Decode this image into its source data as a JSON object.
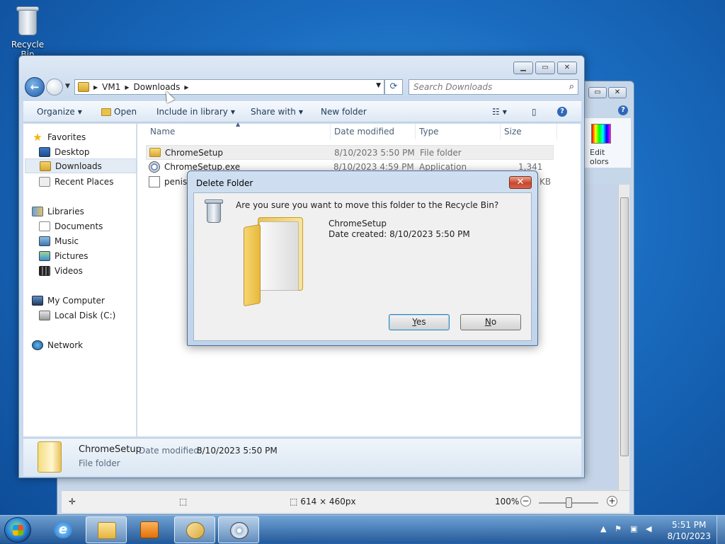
{
  "desktop": {
    "recycle_bin_label": "Recycle Bin"
  },
  "paint_window": {
    "edit_colors_label": "Edit colors",
    "edit_colors_visible": "Edit\nolors",
    "status": {
      "dimensions": "614 × 460px",
      "zoom": "100%",
      "zoom_minus": "−",
      "zoom_plus": "+"
    }
  },
  "explorer": {
    "address": {
      "segments": [
        "VM1",
        "Downloads"
      ]
    },
    "search_placeholder": "Search Downloads",
    "toolbar": {
      "organize": "Organize",
      "open": "Open",
      "include_in_library": "Include in library",
      "share_with": "Share with",
      "new_folder": "New folder"
    },
    "nav": {
      "favorites": "Favorites",
      "desktop": "Desktop",
      "downloads": "Downloads",
      "recent_places": "Recent Places",
      "libraries": "Libraries",
      "documents": "Documents",
      "music": "Music",
      "pictures": "Pictures",
      "videos": "Videos",
      "my_computer": "My Computer",
      "local_disk": "Local Disk (C:)",
      "network": "Network"
    },
    "columns": {
      "name": "Name",
      "date_modified": "Date modified",
      "type": "Type",
      "size": "Size"
    },
    "files": [
      {
        "name": "ChromeSetup",
        "date": "8/10/2023 5:50 PM",
        "type": "File folder",
        "size": ""
      },
      {
        "name": "ChromeSetup.exe",
        "date": "8/10/2023 4:59 PM",
        "type": "Application",
        "size": "1,341 KB"
      },
      {
        "name": "penis.",
        "date": "",
        "type": "",
        "size": "KB"
      }
    ],
    "details": {
      "name": "ChromeSetup",
      "date_label": "Date modified:",
      "date_value": "8/10/2023 5:50 PM",
      "type": "File folder"
    }
  },
  "dialog": {
    "title": "Delete Folder",
    "close": "✕",
    "question": "Are you sure you want to move this folder to the Recycle Bin?",
    "item_name": "ChromeSetup",
    "item_created": "Date created: 8/10/2023 5:50 PM",
    "yes_label": "Yes",
    "no_label": "No"
  },
  "taskbar": {
    "time": "5:51 PM",
    "date": "8/10/2023"
  }
}
